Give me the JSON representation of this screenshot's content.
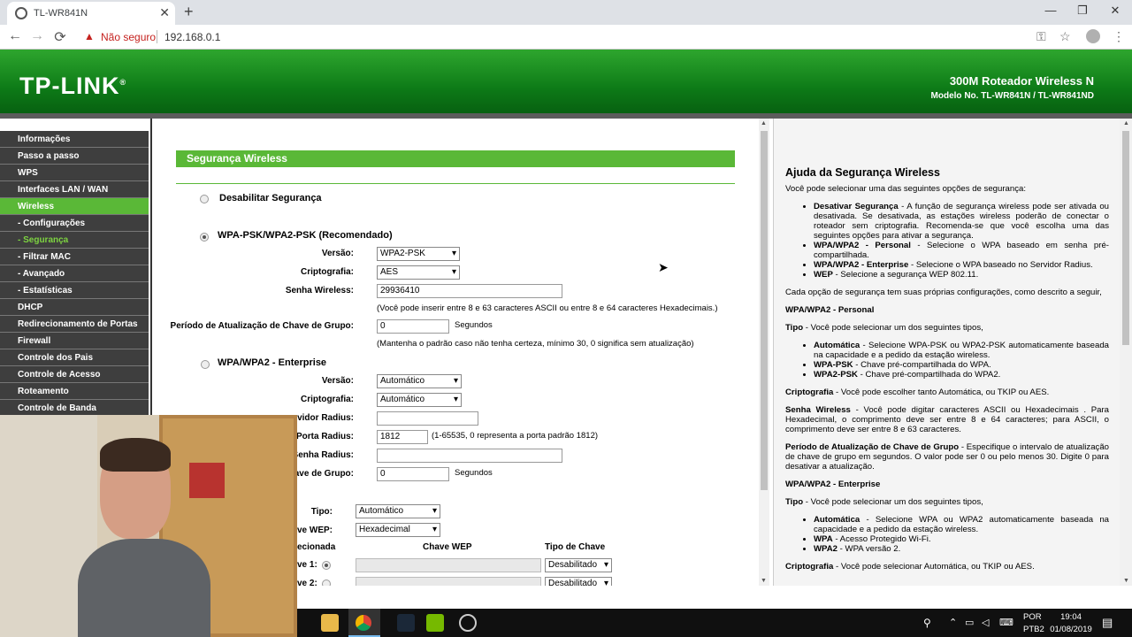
{
  "browser": {
    "tab_title": "TL-WR841N",
    "tab_close": "✕",
    "new_tab": "+",
    "minimize": "—",
    "maximize": "❐",
    "close": "✕",
    "back": "←",
    "forward": "→",
    "reload": "⟳",
    "security_label": "Não seguro",
    "url": "192.168.0.1",
    "warning_icon": "▲",
    "key_icon": "⚿",
    "star_icon": "☆",
    "menu_icon": "⋮"
  },
  "header": {
    "logo": "TP-LINK",
    "logo_mark": "®",
    "title": "300M Roteador Wireless N",
    "model": "Modelo No. TL-WR841N / TL-WR841ND"
  },
  "sidebar": {
    "items": [
      {
        "label": "Informações"
      },
      {
        "label": "Passo a passo"
      },
      {
        "label": "WPS"
      },
      {
        "label": "Interfaces LAN / WAN"
      },
      {
        "label": "Wireless"
      },
      {
        "label": "- Configurações"
      },
      {
        "label": "- Segurança"
      },
      {
        "label": "- Filtrar MAC"
      },
      {
        "label": "- Avançado"
      },
      {
        "label": "- Estatísticas"
      },
      {
        "label": "DHCP"
      },
      {
        "label": "Redirecionamento de Portas"
      },
      {
        "label": "Firewall"
      },
      {
        "label": "Controle dos Pais"
      },
      {
        "label": "Controle de Acesso"
      },
      {
        "label": "Roteamento"
      },
      {
        "label": "Controle de Banda"
      }
    ]
  },
  "main": {
    "section_title": "Segurança Wireless",
    "opt_disable": "Desabilitar Segurança",
    "opt_psk": "WPA-PSK/WPA2-PSK (Recomendado)",
    "psk": {
      "version_label": "Versão:",
      "version_value": "WPA2-PSK",
      "crypto_label": "Criptografia:",
      "crypto_value": "AES",
      "password_label": "Senha Wireless:",
      "password_value": "29936410",
      "password_note": "(Você pode inserir entre 8 e 63 caracteres ASCII ou entre 8 e 64 caracteres Hexadecimais.)",
      "period_label": "Período de Atualização de Chave de Grupo:",
      "period_value": "0",
      "period_unit": "Segundos",
      "period_note": "(Mantenha o padrão caso não tenha certeza, mínimo 30, 0 significa sem atualização)"
    },
    "opt_enterprise": "WPA/WPA2 - Enterprise",
    "ent": {
      "version_label": "Versão:",
      "version_value": "Automático",
      "crypto_label": "Criptografia:",
      "crypto_value": "Automático",
      "radius_ip_label": "rvidor Radius:",
      "radius_ip_value": "",
      "radius_port_label": "Porta Radius:",
      "radius_port_value": "1812",
      "radius_port_note": "(1-65535, 0 representa a porta padrão 1812)",
      "radius_pass_label": "Senha Radius:",
      "radius_pass_value": "",
      "period_label": "ave de Grupo:",
      "period_value": "0",
      "period_unit": "Segundos"
    },
    "wep": {
      "type_label": "Tipo:",
      "type_value": "Automático",
      "format_label": "ave WEP:",
      "format_value": "Hexadecimal",
      "col_selected": "ecionada",
      "col_key": "Chave WEP",
      "col_keytype": "Tipo de Chave",
      "key1_label": "ve 1:",
      "key1_type": "Desabilitado",
      "key2_label": "ve 2:",
      "key2_type": "Desabilitado"
    }
  },
  "help": {
    "title": "Ajuda da Segurança Wireless",
    "intro": "Você pode selecionar uma das seguintes opções de segurança:",
    "opts": [
      {
        "b": "Desativar Segurança",
        "t": " - A função de segurança wireless pode ser ativada ou desativada. Se desativada, as estações wireless poderão de conectar o roteador sem criptografia. Recomenda-se que você escolha uma das seguintes opções para ativar a segurança."
      },
      {
        "b": "WPA/WPA2 - Personal",
        "t": " - Selecione o WPA baseado em senha pré-compartilhada."
      },
      {
        "b": "WPA/WPA2 - Enterprise",
        "t": " - Selecione o WPA baseado no Servidor Radius."
      },
      {
        "b": "WEP",
        "t": " - Selecione a segurança WEP 802.11."
      }
    ],
    "each": "Cada opção de segurança tem suas próprias configurações, como descrito a seguir,",
    "personal_title": "WPA/WPA2 - Personal",
    "type_b": "Tipo",
    "type_t": " - Você pode selecionar um dos seguintes tipos,",
    "p_types": [
      {
        "b": "Automática",
        "t": " - Selecione WPA-PSK ou WPA2-PSK automaticamente baseada na capacidade e a pedido da estação wireless."
      },
      {
        "b": "WPA-PSK",
        "t": " - Chave pré-compartilhada do WPA."
      },
      {
        "b": "WPA2-PSK",
        "t": " - Chave pré-compartilhada do WPA2."
      }
    ],
    "crypt_b": "Criptografia",
    "crypt_t": " - Você pode escolher tanto Automática, ou TKIP ou AES.",
    "pass_b": "Senha Wireless",
    "pass_t": " - Você pode digitar caracteres ASCII ou Hexadecimais . Para Hexadecimal, o comprimento deve ser entre 8 e 64 caracteres; para ASCII, o comprimento deve ser entre 8 e 63 caracteres.",
    "period_b": "Período de Atualização de Chave de Grupo",
    "period_t": " - Especifique o intervalo de atualização de chave de grupo em segundos. O valor pode ser 0 ou pelo menos 30. Digite 0 para desativar a atualização.",
    "enterprise_title": "WPA/WPA2 - Enterprise",
    "type2_b": "Tipo",
    "type2_t": " - Você pode selecionar um dos seguintes tipos,",
    "e_types": [
      {
        "b": "Automática",
        "t": " - Selecione WPA ou WPA2 automaticamente baseada na capacidade e a pedido da estação wireless."
      },
      {
        "b": "WPA",
        "t": " - Acesso Protegido Wi-Fi."
      },
      {
        "b": "WPA2",
        "t": " - WPA versão 2."
      }
    ],
    "crypt2_b": "Criptografia",
    "crypt2_t": " - Você pode selecionar Automática, ou TKIP ou AES."
  },
  "taskbar": {
    "lang1": "POR",
    "lang2": "PTB2",
    "time": "19:04",
    "date": "01/08/2019"
  }
}
